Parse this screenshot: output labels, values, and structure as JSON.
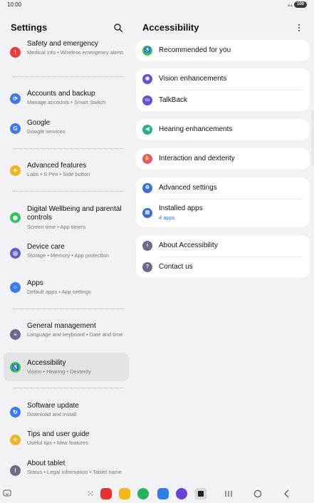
{
  "status": {
    "time": "10:00",
    "battery": "100"
  },
  "left": {
    "title": "Settings",
    "items": [
      {
        "title": "Safety and emergency",
        "sub": "Medical info • Wireless emergency alerts",
        "color": "#e0413b",
        "icon": "alert-icon",
        "glyph": "!"
      },
      {
        "title": "Accounts and backup",
        "sub": "Manage accounts • Smart Switch",
        "color": "#3b7de8",
        "icon": "sync-icon",
        "glyph": "⟳"
      },
      {
        "title": "Google",
        "sub": "Google services",
        "color": "#3b7de8",
        "icon": "google-icon",
        "glyph": "G"
      },
      {
        "title": "Advanced features",
        "sub": "Labs • S Pen • Side button",
        "color": "#f0b429",
        "icon": "star-gear-icon",
        "glyph": "✦"
      },
      {
        "title": "Digital Wellbeing and parental controls",
        "sub": "Screen time • App timers",
        "color": "#3fbf5c",
        "icon": "wellbeing-icon",
        "glyph": "◉"
      },
      {
        "title": "Device care",
        "sub": "Storage • Memory • App protection",
        "color": "#5b5fc7",
        "icon": "device-care-icon",
        "glyph": "◎"
      },
      {
        "title": "Apps",
        "sub": "Default apps • App settings",
        "color": "#3b7de8",
        "icon": "apps-icon",
        "glyph": "⁘"
      },
      {
        "title": "General management",
        "sub": "Language and keyboard • Date and time",
        "color": "#6a6a8a",
        "icon": "sliders-icon",
        "glyph": "≡"
      },
      {
        "title": "Accessibility",
        "sub": "Vision • Hearing • Dexterity",
        "color": "#3fbf5c",
        "icon": "accessibility-icon",
        "glyph": "♿"
      },
      {
        "title": "Software update",
        "sub": "Download and install",
        "color": "#3b7de8",
        "icon": "update-icon",
        "glyph": "↻"
      },
      {
        "title": "Tips and user guide",
        "sub": "Useful tips • New features",
        "color": "#f0b429",
        "icon": "bulb-icon",
        "glyph": "✧"
      },
      {
        "title": "About tablet",
        "sub": "Status • Legal information • Tablet name",
        "color": "#6a6a8a",
        "icon": "info-icon",
        "glyph": "i"
      }
    ]
  },
  "right": {
    "title": "Accessibility",
    "cards": [
      {
        "rows": [
          {
            "label": "Recommended for you",
            "color": "#3fbf5c",
            "icon": "accessibility-icon",
            "glyph": "♿"
          }
        ]
      },
      {
        "rows": [
          {
            "label": "Vision enhancements",
            "color": "#6a4fd1",
            "icon": "vision-icon",
            "glyph": "◉"
          },
          {
            "label": "TalkBack",
            "color": "#6a4fd1",
            "icon": "talkback-icon",
            "glyph": "▭"
          }
        ]
      },
      {
        "rows": [
          {
            "label": "Hearing enhancements",
            "color": "#2ab08f",
            "icon": "hearing-icon",
            "glyph": "◀"
          }
        ]
      },
      {
        "rows": [
          {
            "label": "Interaction and dexterity",
            "color": "#e05a72",
            "icon": "hand-icon",
            "glyph": "✋"
          }
        ]
      },
      {
        "rows": [
          {
            "label": "Advanced settings",
            "color": "#3b6fd6",
            "icon": "gears-icon",
            "glyph": "⚙"
          },
          {
            "label": "Installed apps",
            "sub": "4 apps",
            "color": "#3b6fd6",
            "icon": "installed-apps-icon",
            "glyph": "▤"
          }
        ]
      },
      {
        "rows": [
          {
            "label": "About Accessibility",
            "color": "#6a6a8a",
            "icon": "info-icon",
            "glyph": "i"
          },
          {
            "label": "Contact us",
            "color": "#6a6a8a",
            "icon": "help-icon",
            "glyph": "?"
          }
        ]
      }
    ]
  },
  "nav": {
    "apps": [
      {
        "icon": "app-drawer-icon",
        "color": "#ffffff"
      },
      {
        "icon": "notes-app-icon",
        "color": "#e8322d"
      },
      {
        "icon": "folder-app-icon",
        "color": "#f2b918"
      },
      {
        "icon": "phone-app-icon",
        "color": "#25b25f"
      },
      {
        "icon": "messages-app-icon",
        "color": "#2f7de1"
      },
      {
        "icon": "internet-app-icon",
        "color": "#6b42d6"
      },
      {
        "icon": "camera-app-icon",
        "color": "#d8d8dc"
      }
    ]
  }
}
